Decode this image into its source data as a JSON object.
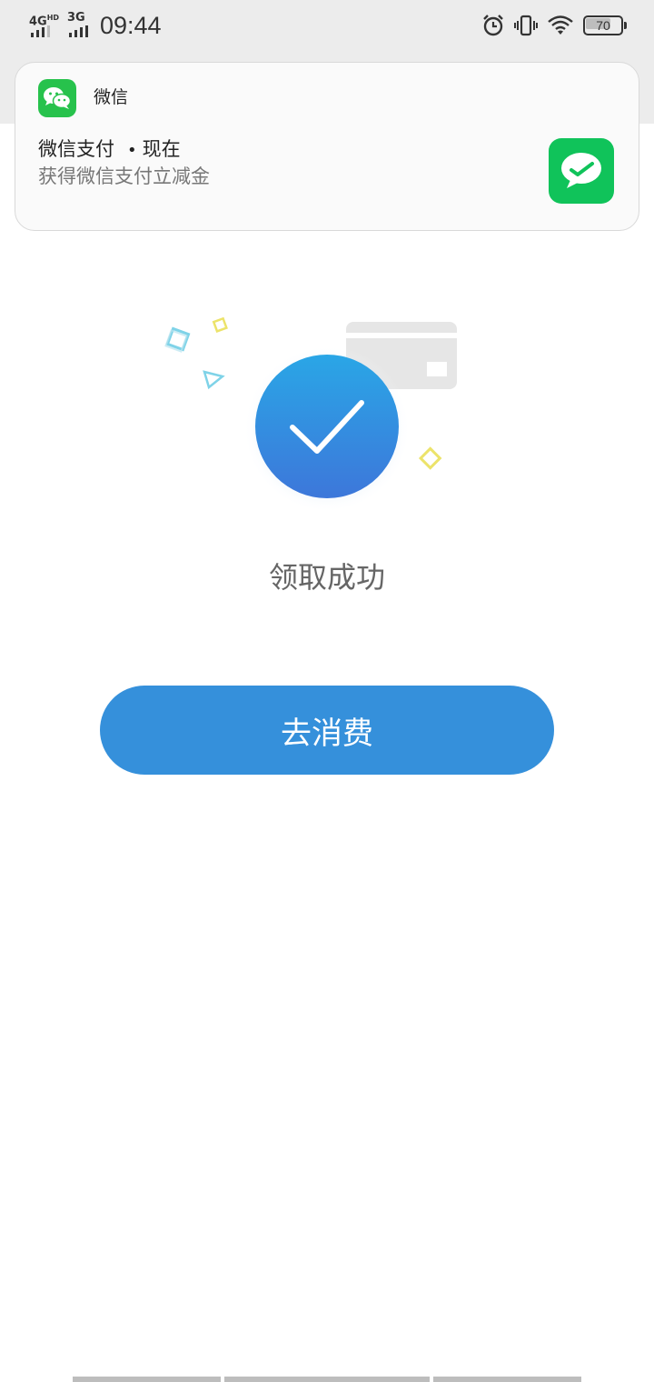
{
  "status_bar": {
    "network_1": "4G",
    "network_1_sup": "HD",
    "network_2": "3G",
    "time": "09:44",
    "battery": "70",
    "battery_level_percent": 70,
    "icons": [
      "alarm-icon",
      "vibrate-icon",
      "wifi-icon",
      "battery-icon"
    ]
  },
  "notification": {
    "app_name": "微信",
    "title": "微信支付",
    "time": "现在",
    "body": "获得微信支付立减金"
  },
  "result": {
    "message": "领取成功",
    "icon": "checkmark-circle-icon"
  },
  "action": {
    "button_label": "去消费"
  },
  "colors": {
    "primary_blue": "#3590db",
    "wechat_green": "#27c24c",
    "status_bar_bg": "#ececec"
  }
}
